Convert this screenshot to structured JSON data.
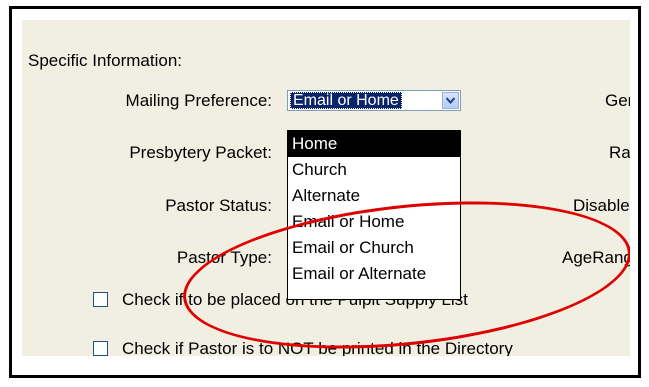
{
  "section": {
    "title": "Specific Information:"
  },
  "fields": {
    "mailing_preference": "Mailing Preference:",
    "presbytery_packet": "Presbytery Packet:",
    "pastor_status": "Pastor Status:",
    "pastor_type": "Pastor Type:",
    "gender": "Gende",
    "race": "Race",
    "disabled": "Disabled",
    "age_range": "AgeRange"
  },
  "mailing_combo": {
    "value": "Email or Home",
    "arrow_icon": "chevron-down-icon"
  },
  "dropdown": {
    "options": [
      "Home",
      "Church",
      "Alternate",
      "Email or Home",
      "Email or Church",
      "Email or Alternate"
    ],
    "selected_index": 0
  },
  "checkboxes": {
    "pulpit_supply": "Check if to be placed on the Pulpit Supply List",
    "directory_exclude": "Check if Pastor is to NOT be printed in the Directory"
  },
  "colors": {
    "panel_bg": "#f1efe2",
    "highlight": "#0a246a",
    "annotation": "#e00000"
  }
}
